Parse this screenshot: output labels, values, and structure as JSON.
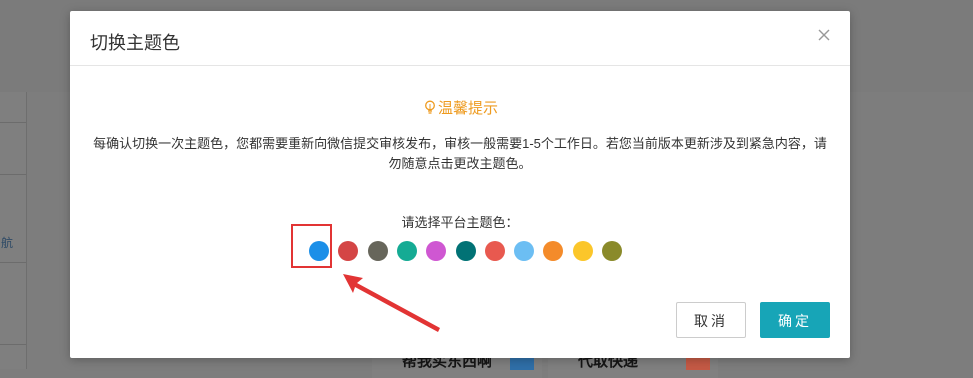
{
  "background": {
    "sidebar_nav_text": "航",
    "cards": [
      {
        "label": "帮我买东西啊",
        "thumb_color": "#2f6fa8"
      },
      {
        "label": "代取快递",
        "thumb_color": "#c55a45"
      }
    ]
  },
  "dialog": {
    "title": "切换主题色",
    "close_icon": "close-x-icon",
    "notice_icon": "lightbulb-icon",
    "notice_title": "温馨提示",
    "notice_body": "每确认切换一次主题色，您都需要重新向微信提交审核发布，审核一般需要1-5个工作日。若您当前版本更新涉及到紧急内容，请勿随意点击更改主题色。",
    "choose_label": "请选择平台主题色：",
    "swatches": [
      "#1b8fe8",
      "#d44545",
      "#67665b",
      "#15ab94",
      "#cf57d2",
      "#017275",
      "#e8594f",
      "#6cbef3",
      "#f48b2a",
      "#fbc62a",
      "#8a8a2a"
    ],
    "selected_index": 0,
    "cancel_label": "取消",
    "confirm_label": "确定",
    "colors": {
      "accent": "#17a5b7",
      "notice": "#ee9b20",
      "annotation": "#e23434"
    }
  }
}
